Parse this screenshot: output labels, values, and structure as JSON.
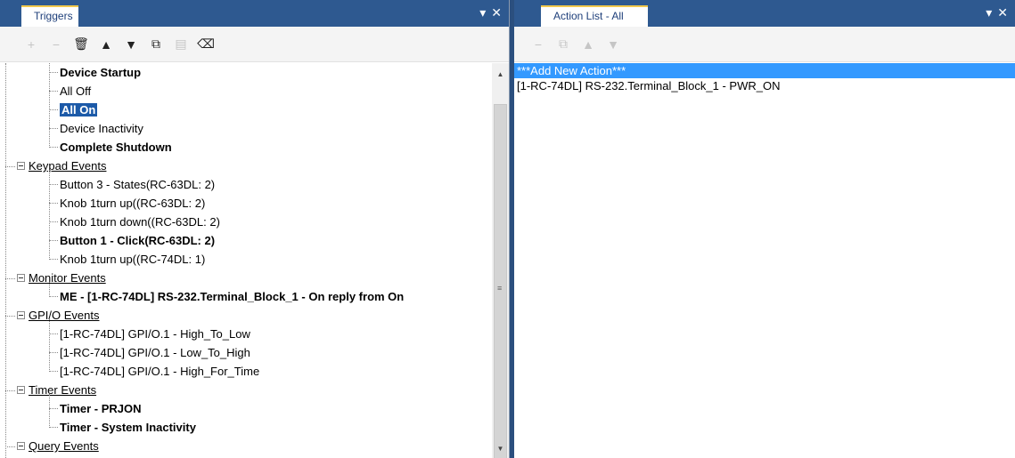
{
  "left_panel": {
    "tab_title": "Triggers",
    "controls": [
      "▾",
      "✕"
    ],
    "toolbar": [
      {
        "icon": "plus-icon",
        "glyph": "+",
        "enabled": false
      },
      {
        "icon": "minus-icon",
        "glyph": "−",
        "enabled": false
      },
      {
        "icon": "trash-icon",
        "glyph": "🗑",
        "enabled": true
      },
      {
        "icon": "arrow-up-icon",
        "glyph": "▲",
        "enabled": true
      },
      {
        "icon": "arrow-down-icon",
        "glyph": "▼",
        "enabled": true
      },
      {
        "icon": "copy-icon",
        "glyph": "⧉",
        "enabled": true
      },
      {
        "icon": "paste-icon",
        "glyph": "▤",
        "enabled": false
      },
      {
        "icon": "eraser-icon",
        "glyph": "⌫",
        "enabled": true
      }
    ],
    "tree": {
      "items": [
        {
          "label": "Device Startup",
          "bold": true
        },
        {
          "label": "All Off"
        },
        {
          "label": "All On",
          "bold": true,
          "selected": true
        },
        {
          "label": "Device Inactivity"
        },
        {
          "label": "Complete Shutdown",
          "bold": true
        }
      ],
      "groups": [
        {
          "label": "Keypad Events",
          "children": [
            {
              "label": "Button 3 - States(RC-63DL: 2)"
            },
            {
              "label": "Knob 1turn up((RC-63DL: 2)"
            },
            {
              "label": "Knob 1turn down((RC-63DL: 2)"
            },
            {
              "label": "Button 1 - Click(RC-63DL: 2)",
              "bold": true
            },
            {
              "label": "Knob 1turn up((RC-74DL: 1)"
            }
          ]
        },
        {
          "label": "Monitor Events",
          "children": [
            {
              "label": "ME - [1-RC-74DL] RS-232.Terminal_Block_1 - On reply from On",
              "bold": true
            }
          ]
        },
        {
          "label": "GPI/O Events",
          "children": [
            {
              "label": "[1-RC-74DL] GPI/O.1 - High_To_Low"
            },
            {
              "label": "[1-RC-74DL] GPI/O.1 - Low_To_High"
            },
            {
              "label": "[1-RC-74DL] GPI/O.1 - High_For_Time"
            }
          ]
        },
        {
          "label": "Timer Events",
          "children": [
            {
              "label": "Timer - PRJON",
              "bold": true
            },
            {
              "label": "Timer - System Inactivity",
              "bold": true
            }
          ]
        },
        {
          "label": "Query Events",
          "children": []
        }
      ]
    }
  },
  "right_panel": {
    "tab_title": "Action List - All On",
    "controls": [
      "▾",
      "✕"
    ],
    "toolbar": [
      {
        "icon": "minus-icon",
        "glyph": "−",
        "enabled": false
      },
      {
        "icon": "copy-icon",
        "glyph": "⧉",
        "enabled": false
      },
      {
        "icon": "arrow-up-icon",
        "glyph": "▲",
        "enabled": false
      },
      {
        "icon": "arrow-down-icon",
        "glyph": "▼",
        "enabled": false
      }
    ],
    "actions": [
      {
        "label": "***Add New Action***",
        "selected": true
      },
      {
        "label": "[1-RC-74DL] RS-232.Terminal_Block_1 - PWR_ON"
      }
    ]
  }
}
